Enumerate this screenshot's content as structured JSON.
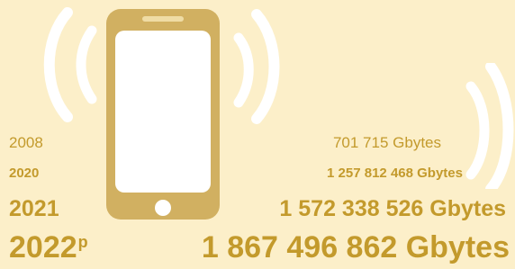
{
  "colors": {
    "background": "#fcefc9",
    "accent": "#c39a2c",
    "phone": "#d1b061",
    "waves": "#ffffff"
  },
  "icons": {
    "phone": "smartphone-icon",
    "signal_left": "signal-waves-left-icon",
    "signal_right": "signal-waves-right-icon"
  },
  "rows": [
    {
      "year": "2008",
      "value": "701 715 Gbytes"
    },
    {
      "year": "2020",
      "value": "1 257 812 468 Gbytes"
    },
    {
      "year": "2021",
      "value": "1 572 338 526 Gbytes"
    },
    {
      "year": "2022",
      "year_sup": "p",
      "value": "1 867 496 862 Gbytes"
    }
  ]
}
